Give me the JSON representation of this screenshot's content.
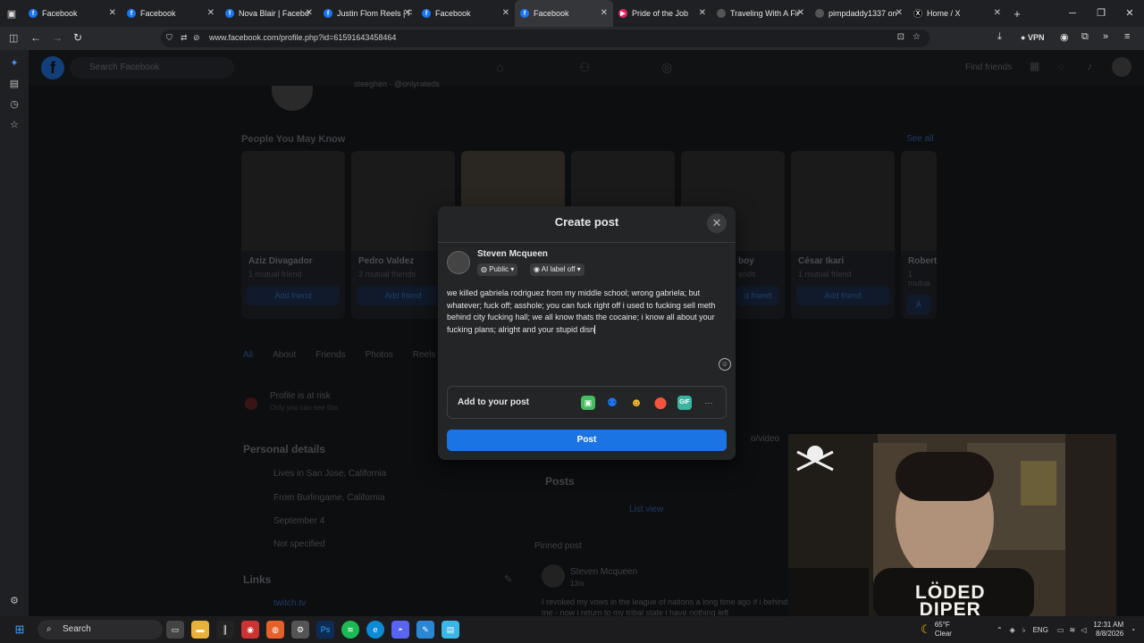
{
  "browser": {
    "tabs": [
      {
        "title": "Facebook",
        "icon": "facebook-icon"
      },
      {
        "title": "Facebook",
        "icon": "facebook-icon"
      },
      {
        "title": "Nova Blair | Facebo",
        "icon": "facebook-icon"
      },
      {
        "title": "Justin Flom Reels | F",
        "icon": "facebook-icon"
      },
      {
        "title": "Facebook",
        "icon": "facebook-icon"
      },
      {
        "title": "Facebook",
        "icon": "facebook-icon",
        "active": true
      },
      {
        "title": "Pride of the Job",
        "icon": "youtube-icon"
      },
      {
        "title": "Traveling With A Fir",
        "icon": "generic-icon"
      },
      {
        "title": "pimpdaddy1337 on",
        "icon": "generic-icon"
      },
      {
        "title": "Home / X",
        "icon": "x-icon"
      }
    ],
    "url": "www.facebook.com/profile.php?id=61591643458464",
    "vpn_label": "VPN"
  },
  "facebook": {
    "search_placeholder": "Search Facebook",
    "find_friends": "Find friends",
    "people_you_may_know": "People You May Know",
    "see_all": "See all",
    "suggestions": [
      {
        "name": "Aziz Divagador",
        "mutual": "1 mutual friend",
        "add": "Add friend"
      },
      {
        "name": "Pedro Valdez",
        "mutual": "3 mutual friends",
        "add": "Add friend"
      },
      {
        "name": "",
        "mutual": "",
        "add": ""
      },
      {
        "name": "",
        "mutual": "",
        "add": ""
      },
      {
        "name": "boy",
        "mutual": "ends",
        "add": "d friend"
      },
      {
        "name": "César Ikari",
        "mutual": "1 mutual friend",
        "add": "Add friend"
      },
      {
        "name": "Robert",
        "mutual": "1 mutua",
        "add": "A"
      }
    ],
    "profile_tabs": [
      "All",
      "About",
      "Friends",
      "Photos",
      "Reels"
    ],
    "profile_risk": "Profile is at risk",
    "profile_risk_sub": "Only you can see this",
    "personal_details_title": "Personal details",
    "details": [
      "Lives in San Jose, California",
      "From Burlingame, California",
      "September 4",
      "Not specified"
    ],
    "links_title": "Links",
    "link_value": "twitch.tv",
    "posts_title": "Posts",
    "list_view": "List view",
    "pinned_post": "Pinned post",
    "pinned_author": "Steven Mcqueen",
    "pinned_time": "13m",
    "pinned_text": "I revoked my vows in the league of nations a long time ago if i behind me - now i return to my tribal state i have nothing left",
    "header_handle": "steeghen · @onlyrateds",
    "photo_video": "o/video"
  },
  "modal": {
    "title": "Create post",
    "author": "Steven Mcqueen",
    "privacy": "Public",
    "ai_label": "AI label off",
    "body": "we killed gabriela rodriguez from my middle school; wrong gabriela; but whatever; fuck off; asshole; you can fuck right off i used to fucking sell meth behind city fucking hall; we all know thats the cocaine; i know all about your fucking plans; alright and your stupid disn",
    "add_to_post": "Add to your post",
    "addto_icons": [
      "photo-icon",
      "tag-people-icon",
      "feeling-icon",
      "location-icon",
      "gif-icon",
      "more-icon"
    ],
    "gif_label": "GIF",
    "more_label": "···",
    "post_button": "Post"
  },
  "webcam": {
    "shirt_text_1": "LÖDED",
    "shirt_text_2": "DIPER"
  },
  "taskbar": {
    "search": "Search",
    "weather_temp": "65°F",
    "weather_desc": "Clear",
    "lang": "ENG",
    "time": "12:31 AM",
    "date": "8/8/2026"
  },
  "colors": {
    "facebook_blue": "#1b74e4",
    "modal_bg": "#242526"
  }
}
